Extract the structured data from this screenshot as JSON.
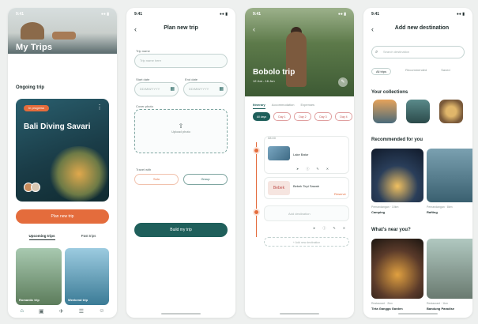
{
  "status": {
    "time": "9:41",
    "icons": "●● ▮"
  },
  "phone1": {
    "title": "My Trips",
    "ongoing_label": "Ongoing trip",
    "trip_tag": "In progress",
    "trip_name": "Bali Diving Savari",
    "new_trip_button": "Plan new trip",
    "tabs": [
      "Upcoming trips",
      "Past trips"
    ],
    "cards": [
      {
        "caption": "Romantic trip"
      },
      {
        "caption": "Weekend trip"
      }
    ],
    "nav_icons": [
      "home-icon",
      "bag-icon",
      "map-icon",
      "book-icon",
      "user-icon"
    ]
  },
  "phone2": {
    "title": "Plan new trip",
    "name_label": "Trip name",
    "name_placeholder": "Trip name here",
    "start_label": "Start date",
    "start_placeholder": "DD/MM/YYYY",
    "end_label": "End date",
    "end_placeholder": "DD/MM/YYYY",
    "cover_label": "Cover photo",
    "upload_text": "Upload photo",
    "with_label": "Travel with",
    "pill_left": "Solo",
    "pill_right": "Group",
    "submit": "Build my trip"
  },
  "phone3": {
    "title": "Bobolo trip",
    "subtitle": "12 Jun - 16 Jun",
    "tabs": [
      "Itinerary",
      "Accommodation",
      "Expenses"
    ],
    "chips": [
      "All days",
      "Day 1",
      "Day 2",
      "Day 3",
      "Day 4"
    ],
    "item1_time": "08:00",
    "item1_name": "Lake Batur",
    "item2_name": "Bebek Tepi Sawah",
    "item2_cta": "Reserve",
    "add_placeholder": "Add destination",
    "ghost": "+ Add new destination"
  },
  "phone4": {
    "title": "Add new destination",
    "search_placeholder": "Search destination",
    "tabs": [
      "All trips",
      "Recommended",
      "Saved"
    ],
    "collections_label": "Your collections",
    "recommended_label": "Recommended for you",
    "rec": [
      {
        "meta": "Pemandangan · 10km",
        "name": "Camping"
      },
      {
        "meta": "Pemandangan · 8km",
        "name": "Rafting"
      }
    ],
    "near_label": "What's near you?",
    "near": [
      {
        "meta": "Restaurant · 2km",
        "name": "Tirta Gangga Garden"
      },
      {
        "meta": "Restaurant · 1km",
        "name": "Bandung Paradise"
      }
    ]
  }
}
